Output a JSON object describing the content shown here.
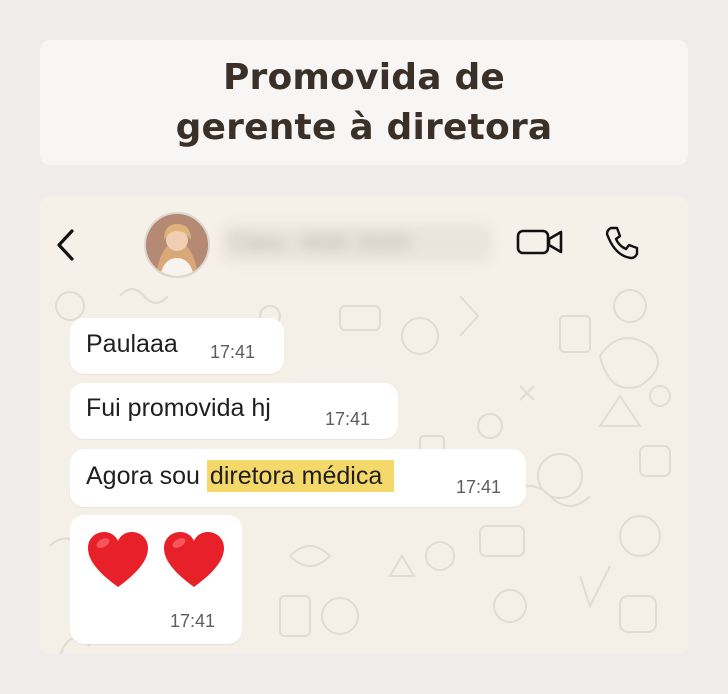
{
  "header_card": {
    "title_line1": "Promovida de",
    "title_line2": "gerente à diretora"
  },
  "chat_header": {
    "contact_name": "Clara - MSE 2025!",
    "back_icon": "chevron-left-icon",
    "video_icon": "video-camera-icon",
    "call_icon": "phone-icon"
  },
  "messages": [
    {
      "text": "Paulaaa",
      "time": "17:41"
    },
    {
      "text": "Fui promovida hj",
      "time": "17:41"
    },
    {
      "text_before": "Agora sou ",
      "text_highlight": "diretora médica",
      "time": "17:41"
    },
    {
      "emoji": "❤️❤️",
      "time": "17:41"
    }
  ],
  "colors": {
    "background": "#efeceb",
    "title_text": "#3a3027",
    "chat_wallpaper": "#f5f0e7",
    "highlight": "#f5d86a",
    "heart": "#e8202a"
  }
}
